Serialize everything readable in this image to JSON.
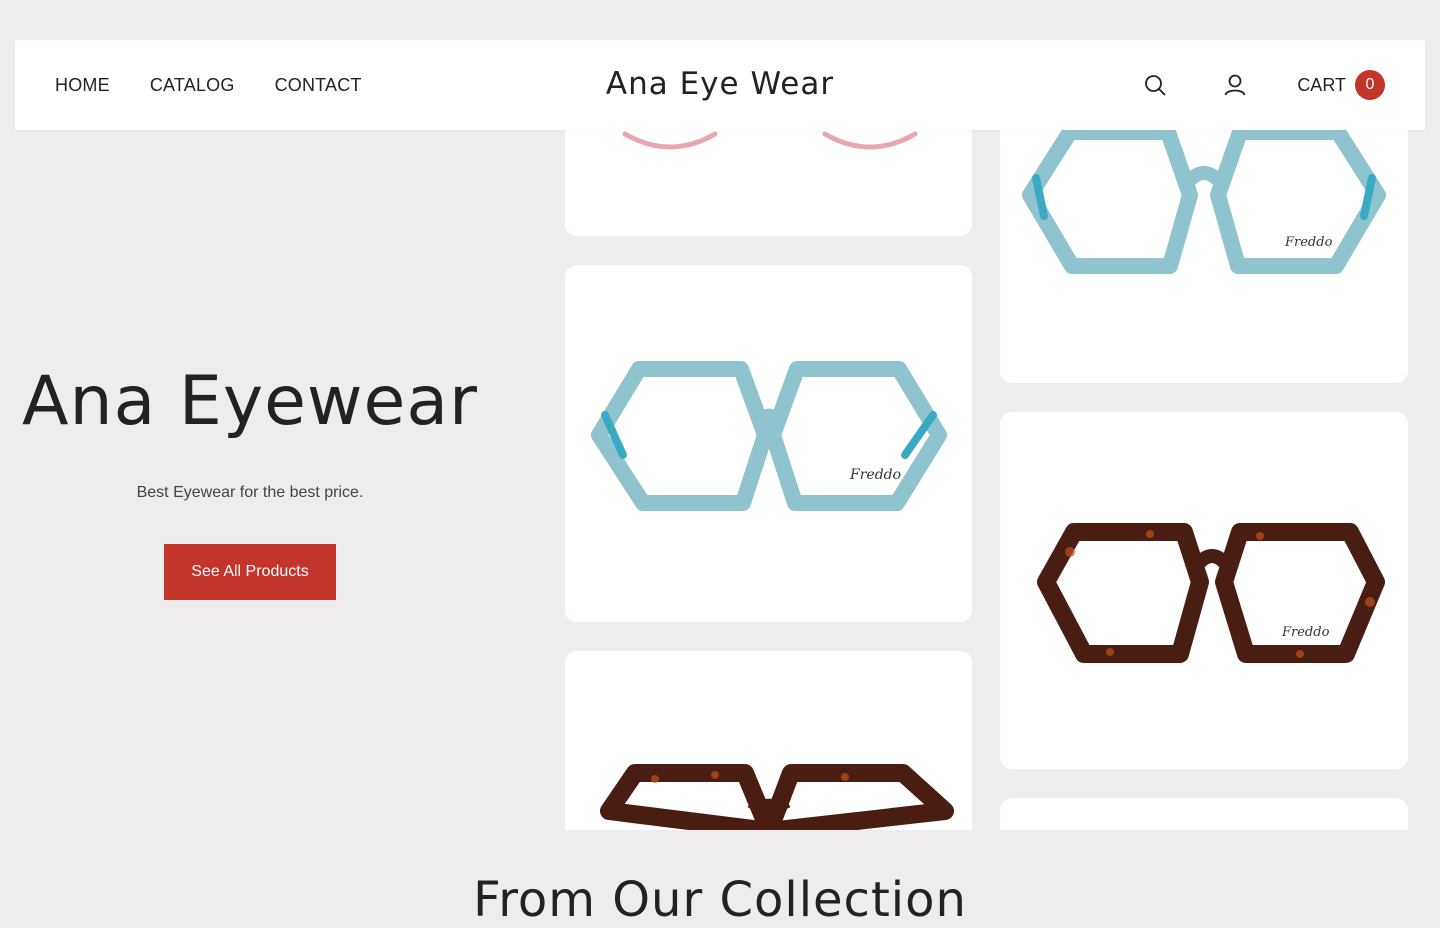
{
  "header": {
    "nav": [
      {
        "label": "HOME"
      },
      {
        "label": "CATALOG"
      },
      {
        "label": "CONTACT"
      }
    ],
    "brand": "Ana Eye Wear",
    "icons": {
      "search": "search-icon",
      "account": "user-icon"
    },
    "cart_label": "CART",
    "cart_count": "0"
  },
  "hero": {
    "title": "Ana Eyewear",
    "subtitle": "Best Eyewear for the best price.",
    "button_label": "See All Products"
  },
  "gallery": {
    "products": [
      {
        "name": "pink frame glasses",
        "color": "#e8a7b0"
      },
      {
        "name": "light blue hexagonal glasses",
        "color": "#8fc3ce",
        "brand_mark": "Freddo"
      },
      {
        "name": "light blue hexagonal glasses",
        "color": "#8fc3ce",
        "brand_mark": "Freddo"
      },
      {
        "name": "tortoise hexagonal glasses",
        "color": "#4a1d12",
        "brand_mark": "Freddo"
      },
      {
        "name": "tortoise hexagonal glasses",
        "color": "#4a1d12"
      }
    ]
  },
  "colors": {
    "accent": "#c3352a",
    "background": "#eeecec"
  },
  "collection_heading": "From Our Collection"
}
